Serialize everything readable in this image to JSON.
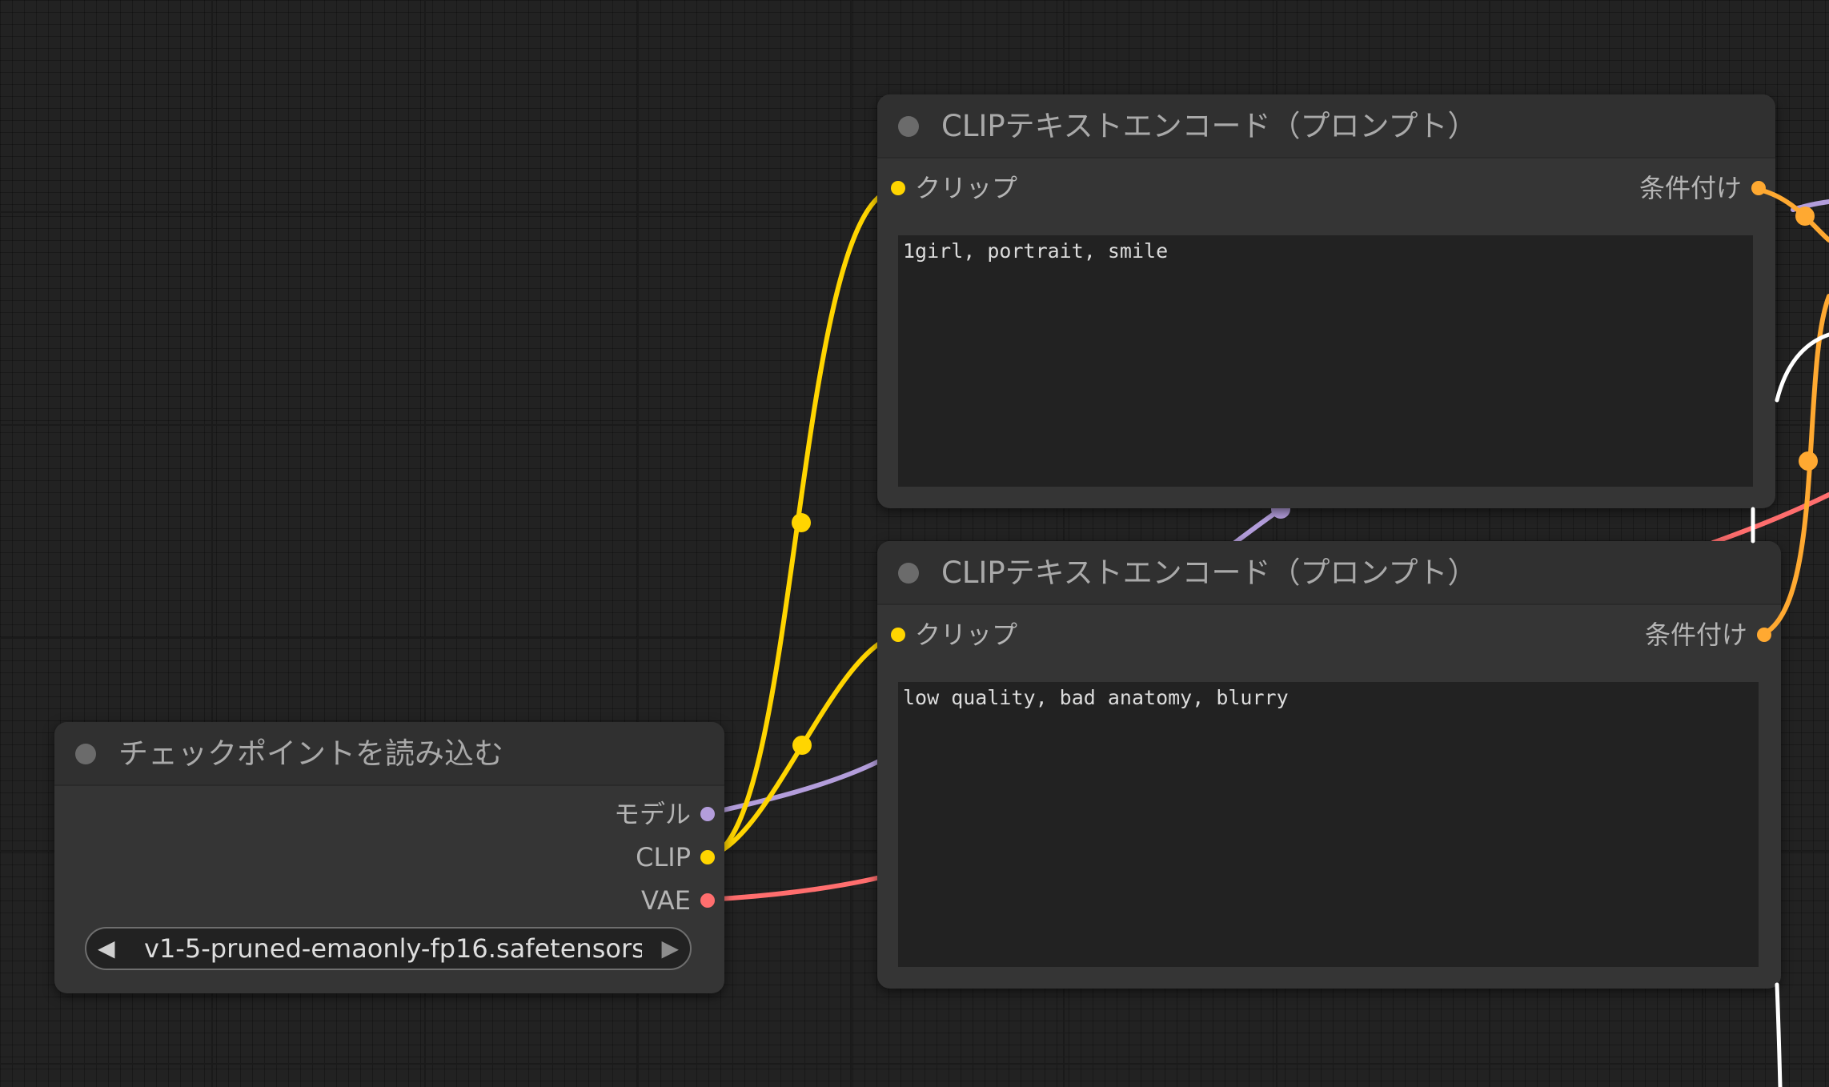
{
  "colors": {
    "model": "#b39ddb",
    "clip": "#ffd500",
    "vae": "#ff6e6e",
    "conditioning": "#ffa931",
    "image": "#ffffff"
  },
  "nodes": {
    "checkpoint_loader": {
      "title": "チェックポイントを読み込む",
      "outputs": {
        "model": "モデル",
        "clip": "CLIP",
        "vae": "VAE"
      },
      "ckpt_name": "v1-5-pruned-emaonly-fp16.safetensors"
    },
    "clip_text_positive": {
      "title": "CLIPテキストエンコード（プロンプト）",
      "input_clip": "クリップ",
      "output_conditioning": "条件付け",
      "text": "1girl, portrait, smile"
    },
    "clip_text_negative": {
      "title": "CLIPテキストエンコード（プロンプト）",
      "input_clip": "クリップ",
      "output_conditioning": "条件付け",
      "text": "low quality, bad anatomy, blurry"
    }
  }
}
